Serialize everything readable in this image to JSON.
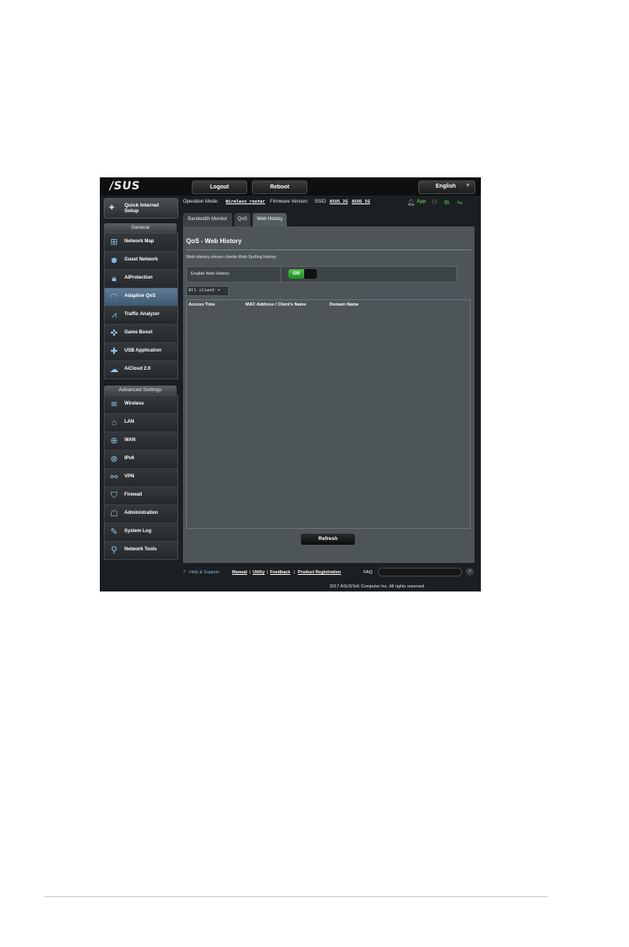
{
  "topbar": {
    "logo": "/SUS",
    "logout": "Logout",
    "reboot": "Reboot",
    "language": "English"
  },
  "status": {
    "operation_mode_label": "Operation Mode:",
    "operation_mode_value": "Wireless router",
    "firmware_label": "Firmware Version:",
    "ssid_label": "SSID:",
    "ssid_2g": "ASUS_2G",
    "ssid_5g": "ASUS_5G",
    "app_label": "App"
  },
  "sidebar": {
    "quick_setup": "Quick Internet Setup",
    "general_title": "General",
    "general_items": [
      {
        "label": "Network Map",
        "icon": "network-map-icon"
      },
      {
        "label": "Guest Network",
        "icon": "guest-network-icon"
      },
      {
        "label": "AiProtection",
        "icon": "lock-icon"
      },
      {
        "label": "Adaptive QoS",
        "icon": "gauge-icon"
      },
      {
        "label": "Traffic Analyzer",
        "icon": "chart-icon"
      },
      {
        "label": "Game Boost",
        "icon": "gamepad-icon"
      },
      {
        "label": "USB Application",
        "icon": "puzzle-icon"
      },
      {
        "label": "AiCloud 2.0",
        "icon": "cloud-icon"
      }
    ],
    "advanced_title": "Advanced Settings",
    "advanced_items": [
      {
        "label": "Wireless",
        "icon": "wifi-icon"
      },
      {
        "label": "LAN",
        "icon": "home-icon"
      },
      {
        "label": "WAN",
        "icon": "globe-icon"
      },
      {
        "label": "IPv6",
        "icon": "globe-ipv6-icon"
      },
      {
        "label": "VPN",
        "icon": "vpn-icon"
      },
      {
        "label": "Firewall",
        "icon": "shield-icon"
      },
      {
        "label": "Administration",
        "icon": "admin-icon"
      },
      {
        "label": "System Log",
        "icon": "log-icon"
      },
      {
        "label": "Network Tools",
        "icon": "tools-icon"
      }
    ]
  },
  "tabs": [
    "Bandwidth Monitor",
    "QoS",
    "Web History"
  ],
  "content": {
    "title": "QoS - Web History",
    "description": "Web History shows clients Web Surfing history.",
    "enable_label": "Enable Web History",
    "toggle_state": "ON",
    "client_select": "All client",
    "columns": [
      "Access Time",
      "MAC Address / Client's Name",
      "Domain Name"
    ],
    "refresh": "Refresh"
  },
  "footer": {
    "help": "Help & Support",
    "manual": "Manual",
    "utility": "Utility",
    "feedback": "Feedback",
    "registration": "Product Registration",
    "faq": "FAQ",
    "copyright": "2017 ASUSTeK Computer Inc. All rights reserved."
  }
}
